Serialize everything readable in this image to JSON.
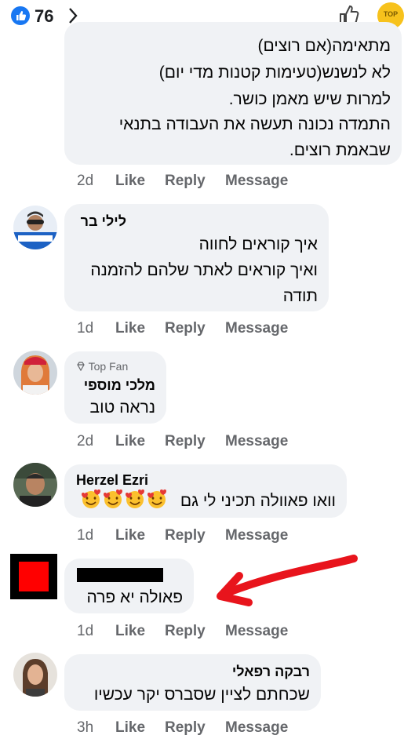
{
  "header": {
    "like_count": "76",
    "page_logo_text": "TOP"
  },
  "comments": [
    {
      "lines": [
        "מתאימה(אם רוצים)",
        "לא לנשנש(טעימות קטנות מדי יום)",
        "למרות שיש מאמן כושר.",
        "התמדה נכונה תעשה את העבודה בתנאי",
        "שבאמת רוצים."
      ],
      "time": "2d"
    },
    {
      "name": "לילי בר",
      "lines": [
        "איך קוראים לחווה",
        "ואיך קוראים לאתר שלהם להזמנה",
        "תודה"
      ],
      "time": "1d"
    },
    {
      "badge": "Top Fan",
      "name": "מלכי מוספי",
      "lines": [
        "נראה טוב"
      ],
      "time": "2d"
    },
    {
      "name": "Herzel Ezri",
      "text": "וואו פאוולה תכיני לי גם",
      "time": "1d"
    },
    {
      "name": "",
      "lines": [
        "פאולה יא פרה"
      ],
      "time": "1d"
    },
    {
      "name": "רבקה רפאלי",
      "lines": [
        "שכחתם לציין שסברס יקר עכשיו"
      ],
      "time": "3h"
    }
  ],
  "actions": {
    "like": "Like",
    "reply": "Reply",
    "message": "Message"
  },
  "colors": {
    "bubble": "#f0f2f5",
    "meta": "#65676b",
    "arrow": "#e8141c",
    "like_blue": "#1877f2",
    "redaction": "#ff0000"
  }
}
